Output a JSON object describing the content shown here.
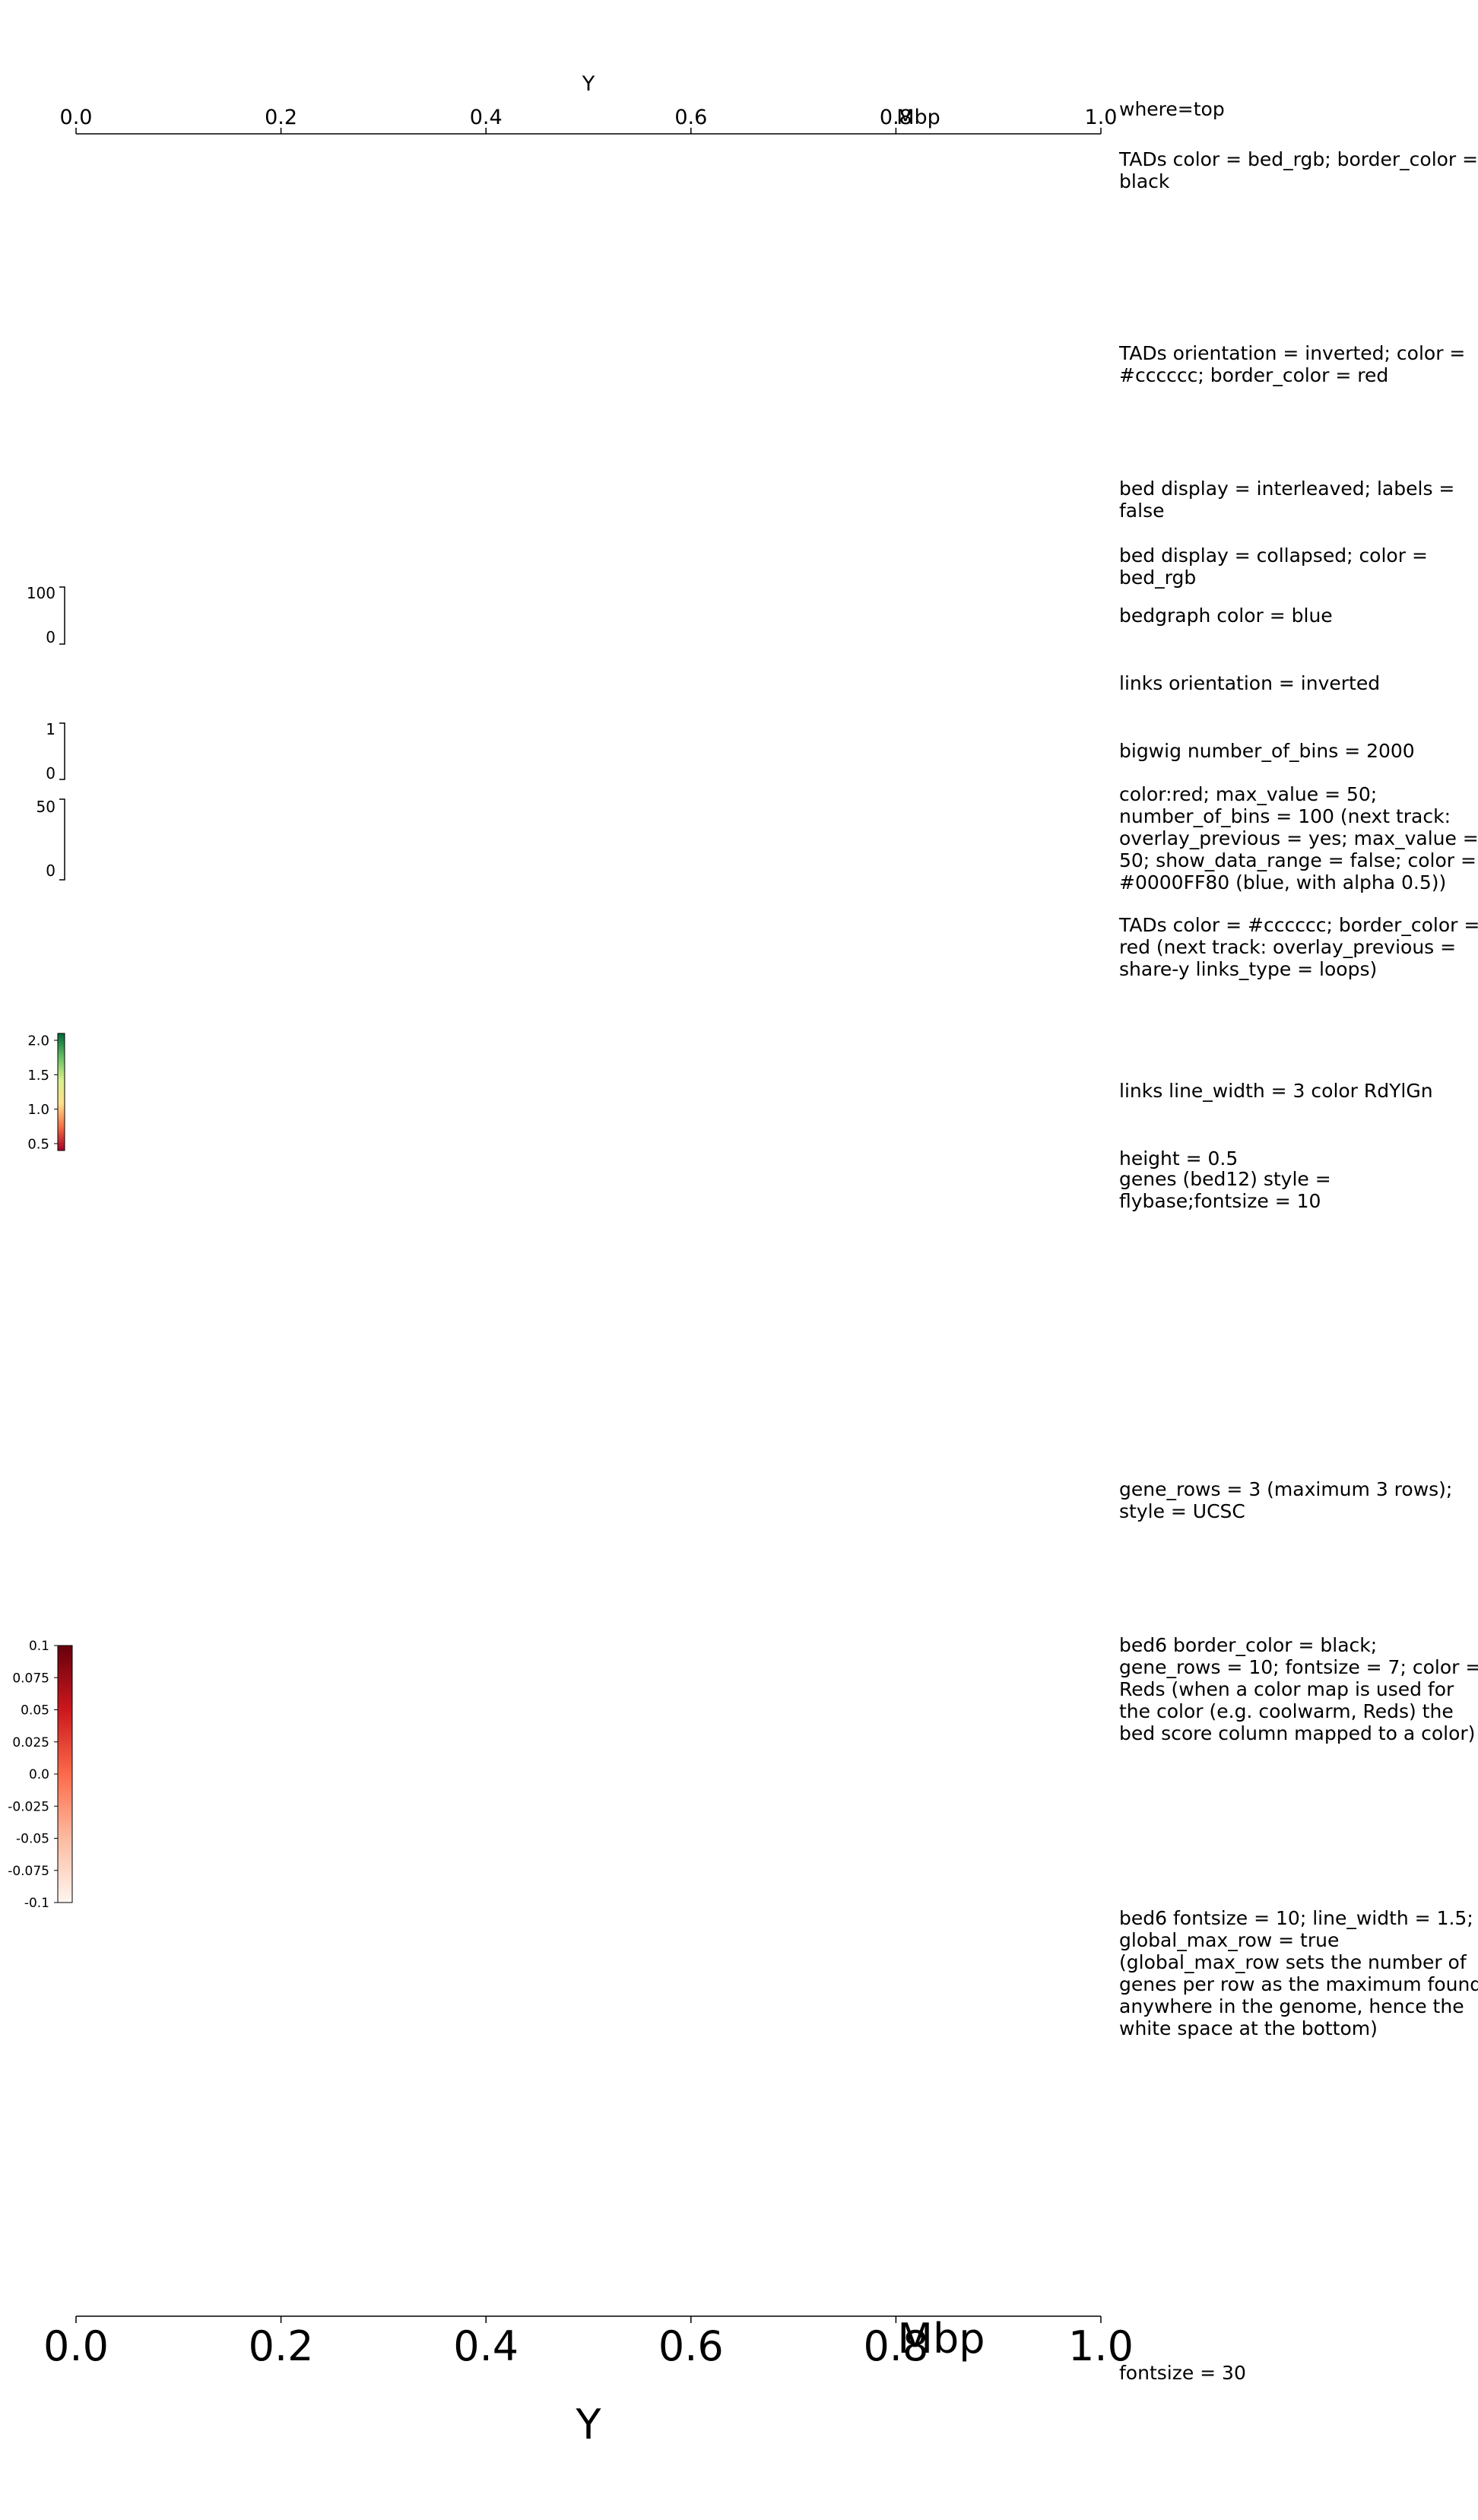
{
  "chart_data": {
    "type": "genome-tracks",
    "chromosome": "Y",
    "x_unit": "Mbp",
    "xlim": [
      0.0,
      1.0
    ],
    "x_ticks": [
      "0.0",
      "0.2",
      "0.4",
      "0.6",
      "0.8",
      "1.0"
    ],
    "top_axis": {
      "chrom_label": "Y",
      "unit": "Mbp"
    },
    "bottom_axis": {
      "chrom_label": "Y",
      "unit": "Mbp"
    },
    "data_ranges": [
      {
        "id": "bedgraph",
        "max": "100",
        "min": "0"
      },
      {
        "id": "bigwig",
        "max": "1",
        "min": "0"
      },
      {
        "id": "bigwig_overlay",
        "max": "50",
        "min": "0"
      }
    ],
    "colorbars": [
      {
        "id": "links_rdylgn",
        "colormap": [
          "#a50026",
          "#f46d43",
          "#fee08b",
          "#d9ef8b",
          "#66bd63",
          "#006837"
        ],
        "range": [
          0.4,
          2.1
        ],
        "ticks": [
          {
            "label": "2.0",
            "value": 2.0
          },
          {
            "label": "1.5",
            "value": 1.5
          },
          {
            "label": "1.0",
            "value": 1.0
          },
          {
            "label": "0.5",
            "value": 0.5
          }
        ]
      },
      {
        "id": "bed6_reds",
        "colormap": [
          "#fff5f0",
          "#fcbba1",
          "#fb6a4a",
          "#cb181d",
          "#67000d"
        ],
        "range": [
          -0.1,
          0.1
        ],
        "ticks": [
          {
            "label": "0.1",
            "value": 0.1
          },
          {
            "label": "0.075",
            "value": 0.075
          },
          {
            "label": "0.05",
            "value": 0.05
          },
          {
            "label": "0.025",
            "value": 0.025
          },
          {
            "label": "0.0",
            "value": 0.0
          },
          {
            "label": "-0.025",
            "value": -0.025
          },
          {
            "label": "-0.05",
            "value": -0.05
          },
          {
            "label": "-0.075",
            "value": -0.075
          },
          {
            "label": "-0.1",
            "value": -0.1
          }
        ]
      }
    ],
    "track_labels": [
      "where=top",
      "TADs color = bed_rgb; border_color = black",
      "TADs orientation = inverted; color = #cccccc; border_color = red",
      "bed display = interleaved; labels = false",
      "bed display = collapsed; color = bed_rgb",
      "bedgraph color = blue",
      "links orientation = inverted",
      "bigwig number_of_bins = 2000",
      "color:red; max_value = 50; number_of_bins = 100 (next track: overlay_previous = yes; max_value = 50; show_data_range = false; color = #0000FF80 (blue, with alpha 0.5))",
      "TADs color = #cccccc; border_color = red (next track: overlay_previous = share-y links_type = loops)",
      "links line_width = 3 color RdYlGn",
      "height = 0.5",
      "genes (bed12) style = flybase;fontsize = 10",
      "gene_rows = 3 (maximum 3 rows); style = UCSC",
      "bed6 border_color = black; gene_rows = 10; fontsize = 7; color = Reds (when a color map is used for the color (e.g. coolwarm, Reds) the bed score column mapped to a color)",
      "bed6 fontsize = 10; line_width = 1.5; global_max_row = true (global_max_row sets the number of genes per row as the maximum found anywhere in the genome, hence the white space at the bottom)",
      "fontsize = 30"
    ]
  },
  "labels": {
    "l0": "where=top",
    "l1a": "TADs color = bed_rgb; border_color =",
    "l1b": "black",
    "l2a": "TADs orientation = inverted; color =",
    "l2b": "#cccccc; border_color = red",
    "l3a": "bed display = interleaved; labels =",
    "l3b": "false",
    "l4a": "bed display = collapsed; color =",
    "l4b": "bed_rgb",
    "l5": "bedgraph color = blue",
    "l6": "links orientation = inverted",
    "l7": "bigwig number_of_bins = 2000",
    "l8a": "color:red; max_value = 50;",
    "l8b": "number_of_bins = 100 (next track:",
    "l8c": "overlay_previous = yes; max_value =",
    "l8d": "50; show_data_range = false; color =",
    "l8e": "#0000FF80 (blue, with alpha 0.5))",
    "l9a": "TADs color = #cccccc; border_color =",
    "l9b": "red (next track: overlay_previous =",
    "l9c": "share-y links_type = loops)",
    "l10": "links line_width = 3 color RdYlGn",
    "l11": "height = 0.5",
    "l12a": "genes (bed12) style =",
    "l12b": "flybase;fontsize = 10",
    "l13a": "gene_rows = 3 (maximum 3 rows);",
    "l13b": "style = UCSC",
    "l14a": "bed6 border_color = black;",
    "l14b": "gene_rows = 10; fontsize = 7; color =",
    "l14c": "Reds (when a color map is used for",
    "l14d": "the color (e.g. coolwarm, Reds) the",
    "l14e": "bed score column mapped to a color)",
    "l15a": "bed6 fontsize = 10; line_width = 1.5;",
    "l15b": "global_max_row = true",
    "l15c": "(global_max_row sets the number of",
    "l15d": "genes per row as the maximum found",
    "l15e": "anywhere in the genome, hence the",
    "l15f": "white space at the bottom)",
    "l16": "fontsize = 30"
  }
}
